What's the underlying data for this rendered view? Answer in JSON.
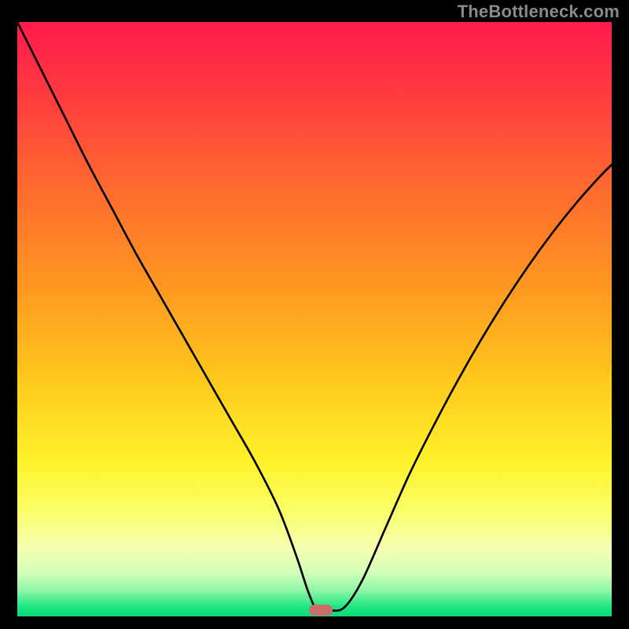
{
  "watermark": "TheBottleneck.com",
  "colors": {
    "curve": "#000000",
    "marker": "#cc6d6a",
    "frame_bg": "#000000"
  },
  "gradient_stops": [
    {
      "offset": 0.0,
      "color": "#ff1a4d"
    },
    {
      "offset": 0.12,
      "color": "#ff3a3f"
    },
    {
      "offset": 0.28,
      "color": "#ff6a2e"
    },
    {
      "offset": 0.45,
      "color": "#ff9920"
    },
    {
      "offset": 0.6,
      "color": "#ffc81c"
    },
    {
      "offset": 0.74,
      "color": "#fff22a"
    },
    {
      "offset": 0.82,
      "color": "#fbff66"
    },
    {
      "offset": 0.885,
      "color": "#f4ffb0"
    },
    {
      "offset": 0.925,
      "color": "#d4ffb8"
    },
    {
      "offset": 0.955,
      "color": "#93f7a8"
    },
    {
      "offset": 0.985,
      "color": "#19e580"
    },
    {
      "offset": 1.0,
      "color": "#0ed978"
    }
  ],
  "chart_data": {
    "type": "line",
    "title": "",
    "xlabel": "",
    "ylabel": "",
    "xlim": [
      0,
      100
    ],
    "ylim": [
      0,
      100
    ],
    "x": [
      0,
      4,
      8,
      12,
      16,
      20,
      24,
      28,
      32,
      36,
      40,
      44,
      47,
      49,
      50.5,
      52.5,
      55,
      58,
      62,
      66,
      70,
      74,
      78,
      82,
      86,
      90,
      94,
      98,
      100
    ],
    "values": [
      100,
      92,
      84,
      76,
      68.5,
      61,
      54,
      47,
      40,
      33,
      26,
      18,
      10,
      4,
      1,
      1,
      1.5,
      6,
      15,
      24,
      32,
      39.5,
      46.5,
      53,
      59,
      64.5,
      69.5,
      74,
      76
    ],
    "marker": {
      "x": 51,
      "y": 1
    },
    "description": "V-shaped bottleneck curve: high mismatch (red) on both extremes, converging to near-zero (green) at the balance point around x≈51."
  }
}
